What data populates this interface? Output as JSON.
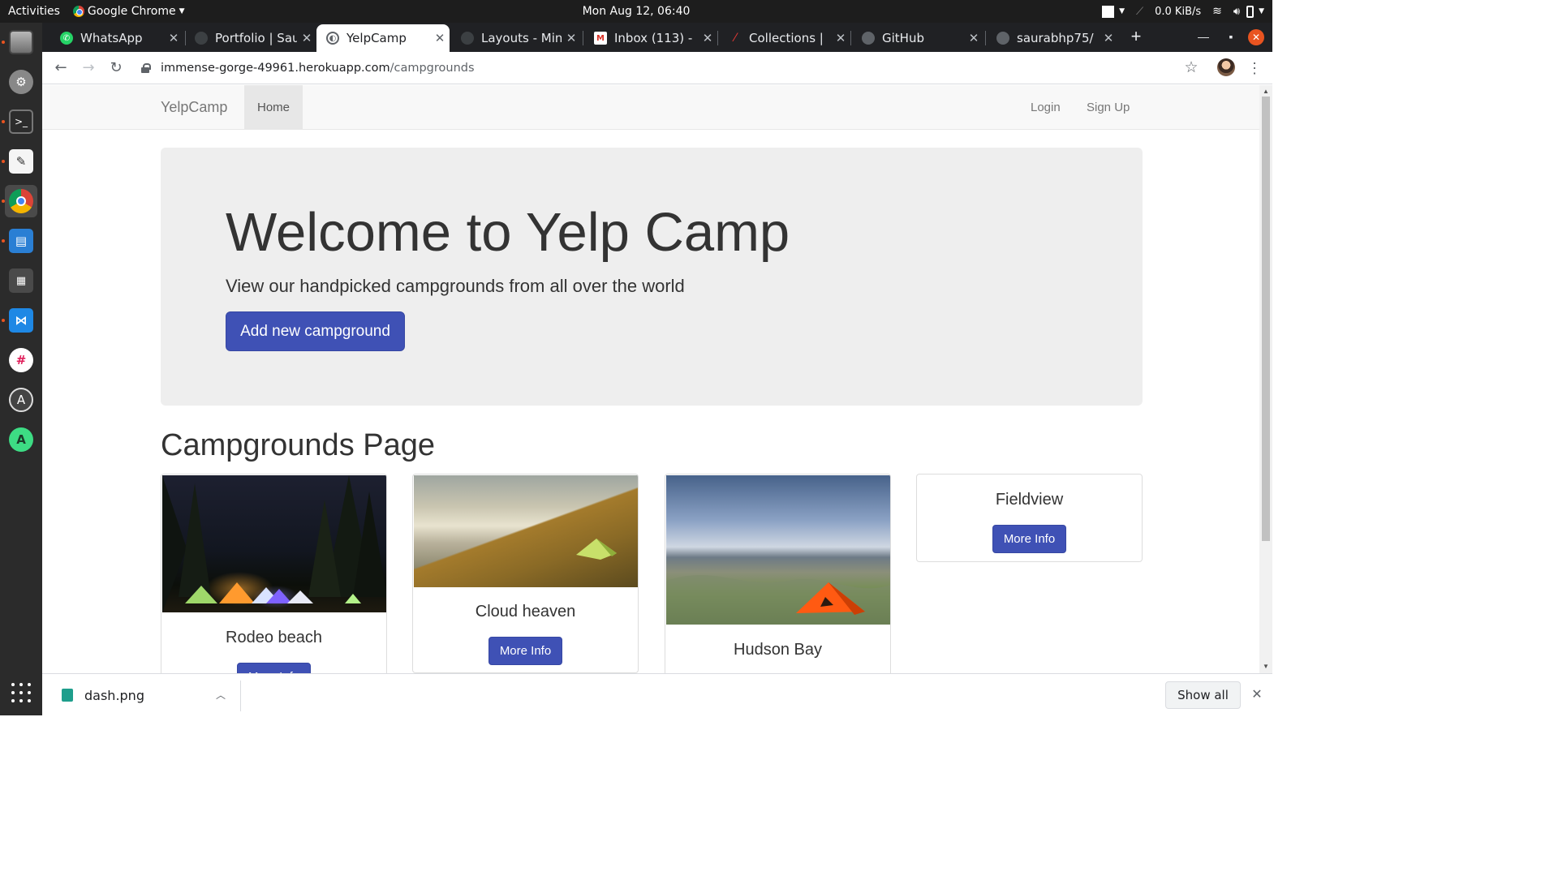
{
  "system": {
    "activities": "Activities",
    "app_name": "Google Chrome",
    "clock": "Mon Aug 12, 06:40",
    "net_speed": "0.0 KiB/s"
  },
  "dock": {
    "items": [
      "files-icon",
      "tools-icon",
      "terminal-icon",
      "text-editor-icon",
      "chrome-icon",
      "writer-icon",
      "calculator-icon",
      "vscode-icon",
      "slack-icon",
      "software-center-icon",
      "android-studio-icon"
    ]
  },
  "browser": {
    "tabs": [
      {
        "title": "WhatsApp"
      },
      {
        "title": "Portfolio | Sau"
      },
      {
        "title": "YelpCamp"
      },
      {
        "title": "Layouts - Min"
      },
      {
        "title": "Inbox (113) -"
      },
      {
        "title": "Collections |"
      },
      {
        "title": "GitHub"
      },
      {
        "title": "saurabhp75/"
      }
    ],
    "url_host": "immense-gorge-49961.herokuapp.com",
    "url_path": "/campgrounds"
  },
  "site": {
    "brand": "YelpCamp",
    "nav_home": "Home",
    "nav_login": "Login",
    "nav_signup": "Sign Up",
    "jumbo_title": "Welcome to Yelp Camp",
    "jumbo_sub": "View our handpicked campgrounds from all over the world",
    "add_button": "Add new campground",
    "section_title": "Campgrounds Page",
    "more_info": "More Info",
    "campgrounds": [
      {
        "name": "Rodeo beach"
      },
      {
        "name": "Cloud heaven"
      },
      {
        "name": "Hudson Bay"
      },
      {
        "name": "Fieldview"
      }
    ]
  },
  "downloads": {
    "file": "dash.png",
    "show_all": "Show all"
  },
  "colors": {
    "primary_button": "#3f51b5",
    "navbar_bg": "#f8f8f8",
    "jumbotron_bg": "#eeeeee"
  }
}
